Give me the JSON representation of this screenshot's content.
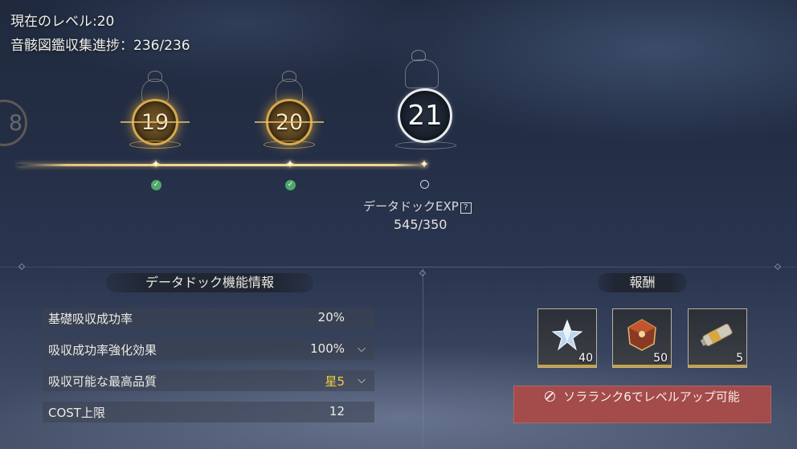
{
  "header": {
    "current_level": "現在のレベル:20",
    "collection_progress": "音骸図鑑収集進捗：236/236"
  },
  "levels": [
    {
      "number": "8",
      "state": "faded"
    },
    {
      "number": "19",
      "state": "completed"
    },
    {
      "number": "20",
      "state": "completed"
    },
    {
      "number": "21",
      "state": "next"
    }
  ],
  "exp": {
    "label": "データドックEXP",
    "help": "?",
    "value": "545/350"
  },
  "info_panel": {
    "title": "データドック機能情報",
    "rows": [
      {
        "label": "基礎吸収成功率",
        "value": "20%",
        "expandable": false
      },
      {
        "label": "吸収成功率強化効果",
        "value": "100%",
        "expandable": true
      },
      {
        "label": "吸収可能な最高品質",
        "value": "星5",
        "expandable": true,
        "highlight": "#f0cf3b"
      },
      {
        "label": "COST上限",
        "value": "12",
        "expandable": false
      }
    ]
  },
  "rewards_panel": {
    "title": "報酬",
    "items": [
      {
        "icon": "crystal-star-icon",
        "count": "40"
      },
      {
        "icon": "tuner-box-icon",
        "count": "50"
      },
      {
        "icon": "battery-cell-icon",
        "count": "5"
      }
    ],
    "button": {
      "label": "ソラランク6でレベルアップ可能",
      "color": "#a44b4b",
      "icon": "prohibited-icon"
    }
  }
}
